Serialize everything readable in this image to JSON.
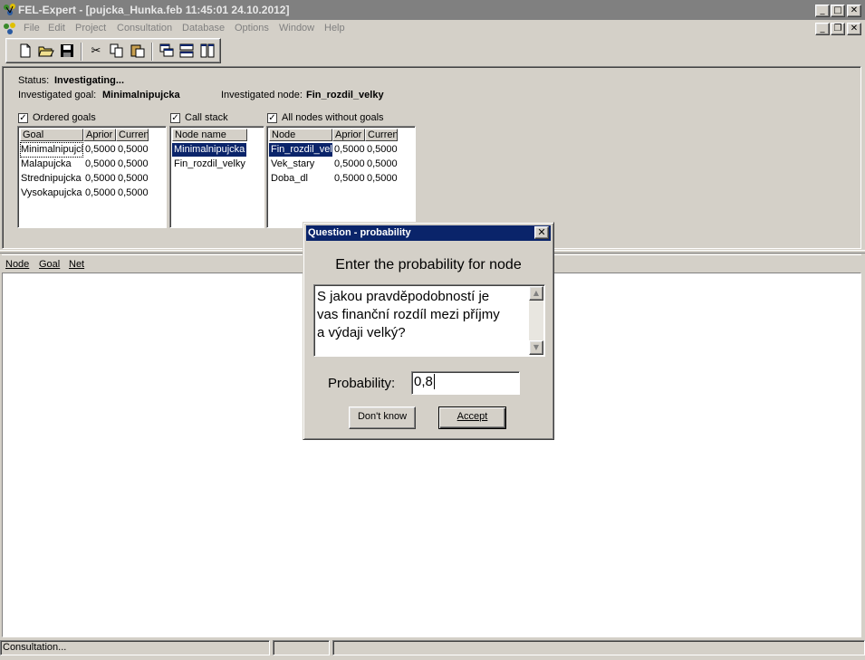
{
  "window": {
    "title": "FEL-Expert - [pujcka_Hunka.feb 11:45:01 24.10.2012]"
  },
  "menu": [
    "File",
    "Edit",
    "Project",
    "Consultation",
    "Database",
    "Options",
    "Window",
    "Help"
  ],
  "toolbar": {
    "icons": [
      "new-icon",
      "open-icon",
      "save-icon",
      "cut-icon",
      "copy-icon",
      "paste-icon",
      "cascade-icon",
      "tile-horizontal-icon",
      "tile-vertical-icon"
    ]
  },
  "status": {
    "label": "Status:",
    "value": "Investigating...",
    "goal_label": "Investigated goal:",
    "goal_value": "Minimalnipujcka",
    "node_label": "Investigated node:",
    "node_value": "Fin_rozdil_velky"
  },
  "ordered_goals": {
    "label": "Ordered goals",
    "checked": true,
    "columns": [
      "Goal",
      "Aprior",
      "Curren"
    ],
    "rows": [
      [
        "Minimalnipujck",
        "0,5000",
        "0,5000"
      ],
      [
        "Malapujcka",
        "0,5000",
        "0,5000"
      ],
      [
        "Strednipujcka",
        "0,5000",
        "0,5000"
      ],
      [
        "Vysokapujcka",
        "0,5000",
        "0,5000"
      ]
    ]
  },
  "call_stack": {
    "label": "Call stack",
    "checked": true,
    "columns": [
      "Node name"
    ],
    "rows": [
      "Minimalnipujcka",
      "Fin_rozdil_velky"
    ]
  },
  "all_nodes": {
    "label": "All nodes without goals",
    "checked": true,
    "columns": [
      "Node",
      "Aprior",
      "Curren"
    ],
    "rows": [
      [
        "Fin_rozdil_velk",
        "0,5000",
        "0,5000"
      ],
      [
        "Vek_stary",
        "0,5000",
        "0,5000"
      ],
      [
        "Doba_dl",
        "0,5000",
        "0,5000"
      ]
    ]
  },
  "lower_tabs": [
    "Node",
    "Goal",
    "Net"
  ],
  "dialog": {
    "title": "Question - probability",
    "prompt": "Enter the probability for node",
    "question": "S jakou pravděpodobností je\nvas finanční rozdíl mezi příjmy\na výdaji velký?",
    "probability_label": "Probability:",
    "probability_value": "0,8",
    "dont_know_label": "Don't know",
    "accept_label": "Accept"
  },
  "statusbar": {
    "text": "Consultation..."
  },
  "colors": {
    "face": "#d4d0c8",
    "selection": "#0a246a",
    "titlebar_inactive": "#808080"
  }
}
